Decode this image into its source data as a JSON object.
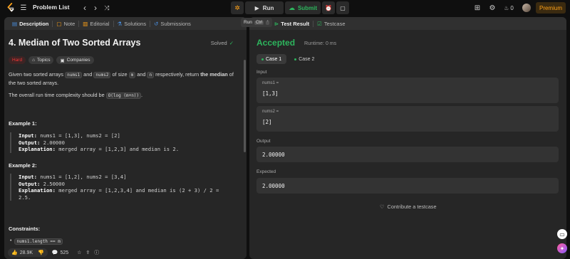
{
  "topbar": {
    "problem_list": "Problem List",
    "run": "Run",
    "submit": "Submit",
    "streak": "0",
    "premium": "Premium"
  },
  "left": {
    "tabs": [
      {
        "label": "Description",
        "icon": "description-icon"
      },
      {
        "label": "Note",
        "icon": "note-icon"
      },
      {
        "label": "Editorial",
        "icon": "editorial-icon"
      },
      {
        "label": "Solutions",
        "icon": "flask-icon"
      },
      {
        "label": "Submissions",
        "icon": "history-icon"
      }
    ],
    "title": "4. Median of Two Sorted Arrays",
    "solved": "Solved",
    "badges": {
      "difficulty": "Hard",
      "topics": "Topics",
      "companies": "Companies"
    },
    "desc": {
      "p1_a": "Given two sorted arrays ",
      "c1": "nums1",
      "p1_b": " and ",
      "c2": "nums2",
      "p1_c": " of size ",
      "c3": "m",
      "p1_d": " and ",
      "c4": "n",
      "p1_e": " respectively, return ",
      "p1_bold": "the median",
      "p1_f": " of the two sorted arrays.",
      "p2_a": "The overall run time complexity should be ",
      "c5": "O(log (m+n))",
      "p2_b": "."
    },
    "example1": {
      "title": "Example 1:",
      "input_label": "Input:",
      "input": " nums1 = [1,3], nums2 = [2]",
      "output_label": "Output:",
      "output": " 2.00000",
      "expl_label": "Explanation:",
      "expl": " merged array = [1,2,3] and median is 2."
    },
    "example2": {
      "title": "Example 2:",
      "input_label": "Input:",
      "input": " nums1 = [1,2], nums2 = [3,4]",
      "output_label": "Output:",
      "output": " 2.50000",
      "expl_label": "Explanation:",
      "expl": " merged array = [1,2,3,4] and median is (2 + 3) / 2 =",
      "expl2": "2.5."
    },
    "constraints_title": "Constraints:",
    "constraint_first": "nums1.length == m",
    "bottom": {
      "likes": "28.9K",
      "comments": "525"
    }
  },
  "right": {
    "tooltip": {
      "label": "Run",
      "key1": "Ctrl",
      "key2": "'"
    },
    "tabs": [
      {
        "label": "Test Result",
        "icon": "test-result-icon"
      },
      {
        "label": "Testcase",
        "icon": "testcase-icon"
      }
    ],
    "status": "Accepted",
    "runtime": "Runtime: 0 ms",
    "cases": [
      "Case 1",
      "Case 2"
    ],
    "input_label": "Input",
    "var1_name": "nums1 =",
    "var1_value": "[1,3]",
    "var2_name": "nums2 =",
    "var2_value": "[2]",
    "output_label": "Output",
    "output_value": "2.00000",
    "expected_label": "Expected",
    "expected_value": "2.00000",
    "contribute": "Contribute a testcase"
  },
  "colors": {
    "accent_green": "#2db55d",
    "hard_red": "#f63636",
    "premium_orange": "#ffa116"
  }
}
